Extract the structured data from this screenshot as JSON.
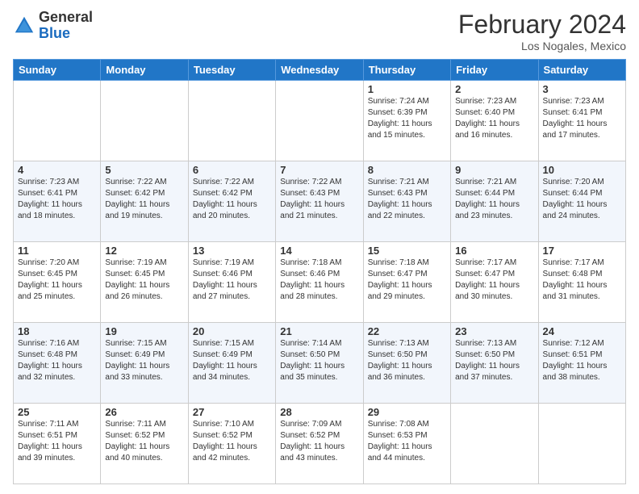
{
  "header": {
    "logo_general": "General",
    "logo_blue": "Blue",
    "month_title": "February 2024",
    "location": "Los Nogales, Mexico"
  },
  "days_of_week": [
    "Sunday",
    "Monday",
    "Tuesday",
    "Wednesday",
    "Thursday",
    "Friday",
    "Saturday"
  ],
  "weeks": [
    [
      {
        "day": "",
        "info": ""
      },
      {
        "day": "",
        "info": ""
      },
      {
        "day": "",
        "info": ""
      },
      {
        "day": "",
        "info": ""
      },
      {
        "day": "1",
        "info": "Sunrise: 7:24 AM\nSunset: 6:39 PM\nDaylight: 11 hours\nand 15 minutes."
      },
      {
        "day": "2",
        "info": "Sunrise: 7:23 AM\nSunset: 6:40 PM\nDaylight: 11 hours\nand 16 minutes."
      },
      {
        "day": "3",
        "info": "Sunrise: 7:23 AM\nSunset: 6:41 PM\nDaylight: 11 hours\nand 17 minutes."
      }
    ],
    [
      {
        "day": "4",
        "info": "Sunrise: 7:23 AM\nSunset: 6:41 PM\nDaylight: 11 hours\nand 18 minutes."
      },
      {
        "day": "5",
        "info": "Sunrise: 7:22 AM\nSunset: 6:42 PM\nDaylight: 11 hours\nand 19 minutes."
      },
      {
        "day": "6",
        "info": "Sunrise: 7:22 AM\nSunset: 6:42 PM\nDaylight: 11 hours\nand 20 minutes."
      },
      {
        "day": "7",
        "info": "Sunrise: 7:22 AM\nSunset: 6:43 PM\nDaylight: 11 hours\nand 21 minutes."
      },
      {
        "day": "8",
        "info": "Sunrise: 7:21 AM\nSunset: 6:43 PM\nDaylight: 11 hours\nand 22 minutes."
      },
      {
        "day": "9",
        "info": "Sunrise: 7:21 AM\nSunset: 6:44 PM\nDaylight: 11 hours\nand 23 minutes."
      },
      {
        "day": "10",
        "info": "Sunrise: 7:20 AM\nSunset: 6:44 PM\nDaylight: 11 hours\nand 24 minutes."
      }
    ],
    [
      {
        "day": "11",
        "info": "Sunrise: 7:20 AM\nSunset: 6:45 PM\nDaylight: 11 hours\nand 25 minutes."
      },
      {
        "day": "12",
        "info": "Sunrise: 7:19 AM\nSunset: 6:45 PM\nDaylight: 11 hours\nand 26 minutes."
      },
      {
        "day": "13",
        "info": "Sunrise: 7:19 AM\nSunset: 6:46 PM\nDaylight: 11 hours\nand 27 minutes."
      },
      {
        "day": "14",
        "info": "Sunrise: 7:18 AM\nSunset: 6:46 PM\nDaylight: 11 hours\nand 28 minutes."
      },
      {
        "day": "15",
        "info": "Sunrise: 7:18 AM\nSunset: 6:47 PM\nDaylight: 11 hours\nand 29 minutes."
      },
      {
        "day": "16",
        "info": "Sunrise: 7:17 AM\nSunset: 6:47 PM\nDaylight: 11 hours\nand 30 minutes."
      },
      {
        "day": "17",
        "info": "Sunrise: 7:17 AM\nSunset: 6:48 PM\nDaylight: 11 hours\nand 31 minutes."
      }
    ],
    [
      {
        "day": "18",
        "info": "Sunrise: 7:16 AM\nSunset: 6:48 PM\nDaylight: 11 hours\nand 32 minutes."
      },
      {
        "day": "19",
        "info": "Sunrise: 7:15 AM\nSunset: 6:49 PM\nDaylight: 11 hours\nand 33 minutes."
      },
      {
        "day": "20",
        "info": "Sunrise: 7:15 AM\nSunset: 6:49 PM\nDaylight: 11 hours\nand 34 minutes."
      },
      {
        "day": "21",
        "info": "Sunrise: 7:14 AM\nSunset: 6:50 PM\nDaylight: 11 hours\nand 35 minutes."
      },
      {
        "day": "22",
        "info": "Sunrise: 7:13 AM\nSunset: 6:50 PM\nDaylight: 11 hours\nand 36 minutes."
      },
      {
        "day": "23",
        "info": "Sunrise: 7:13 AM\nSunset: 6:50 PM\nDaylight: 11 hours\nand 37 minutes."
      },
      {
        "day": "24",
        "info": "Sunrise: 7:12 AM\nSunset: 6:51 PM\nDaylight: 11 hours\nand 38 minutes."
      }
    ],
    [
      {
        "day": "25",
        "info": "Sunrise: 7:11 AM\nSunset: 6:51 PM\nDaylight: 11 hours\nand 39 minutes."
      },
      {
        "day": "26",
        "info": "Sunrise: 7:11 AM\nSunset: 6:52 PM\nDaylight: 11 hours\nand 40 minutes."
      },
      {
        "day": "27",
        "info": "Sunrise: 7:10 AM\nSunset: 6:52 PM\nDaylight: 11 hours\nand 42 minutes."
      },
      {
        "day": "28",
        "info": "Sunrise: 7:09 AM\nSunset: 6:52 PM\nDaylight: 11 hours\nand 43 minutes."
      },
      {
        "day": "29",
        "info": "Sunrise: 7:08 AM\nSunset: 6:53 PM\nDaylight: 11 hours\nand 44 minutes."
      },
      {
        "day": "",
        "info": ""
      },
      {
        "day": "",
        "info": ""
      }
    ]
  ]
}
